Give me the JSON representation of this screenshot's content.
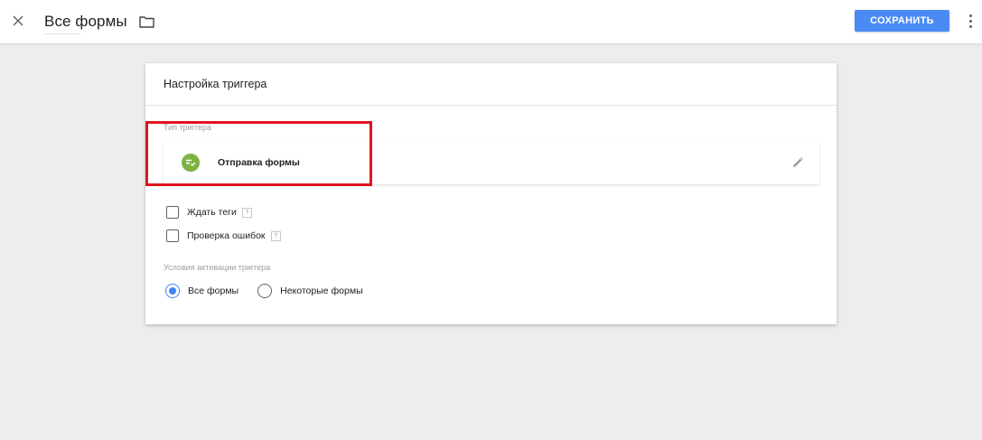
{
  "header": {
    "title": "Все формы",
    "save_label": "СОХРАНИТЬ",
    "icons": {
      "close": "close-icon",
      "folder": "folder-icon",
      "more": "more-vert-icon"
    }
  },
  "card": {
    "title": "Настройка триггера",
    "trigger_type_label": "Тип триггера",
    "trigger_type": {
      "name": "Отправка формы",
      "icon": "form-submit-icon",
      "icon_color": "#7cb342",
      "edit_icon": "pencil-icon"
    },
    "checkboxes": [
      {
        "label": "Ждать теги",
        "checked": false,
        "help": "?"
      },
      {
        "label": "Проверка ошибок",
        "checked": false,
        "help": "?"
      }
    ],
    "conditions_label": "Условия активации триггера",
    "radios": [
      {
        "label": "Все формы",
        "checked": true
      },
      {
        "label": "Некоторые формы",
        "checked": false
      }
    ]
  },
  "colors": {
    "accent": "#4285f4",
    "save_button": "#4a8af4",
    "highlight": "#e0141e",
    "background": "#ededed"
  }
}
